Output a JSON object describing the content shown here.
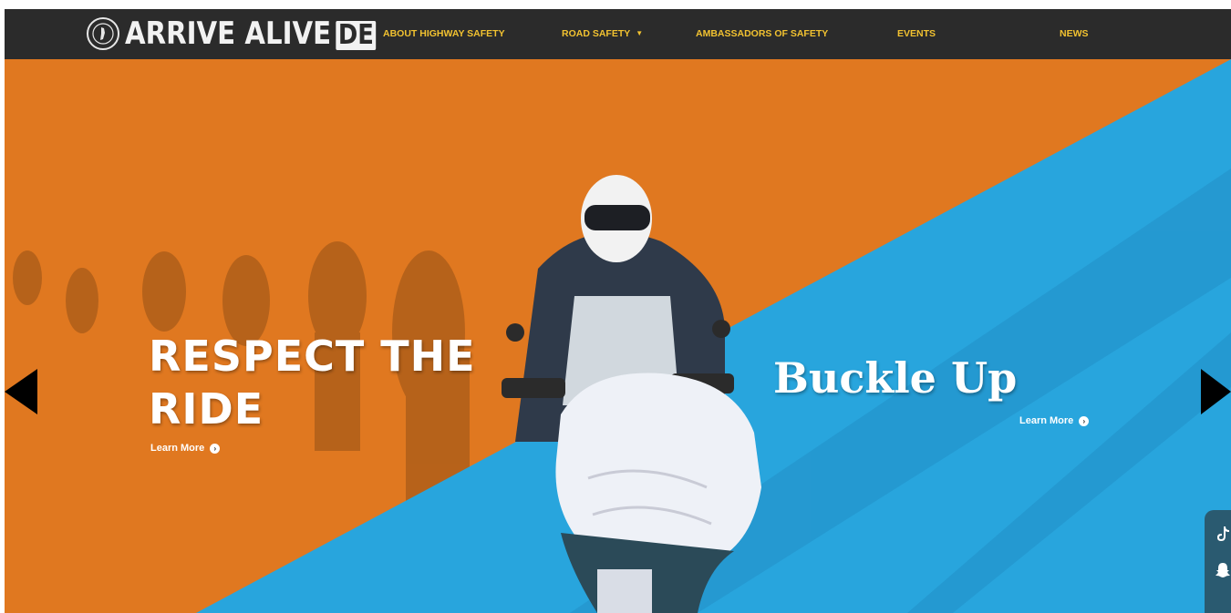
{
  "brand": {
    "logo_text": "ARRIVE ALIVE",
    "badge_text": "DE"
  },
  "nav": {
    "items": [
      {
        "label": "ABOUT HIGHWAY SAFETY"
      },
      {
        "label": "ROAD SAFETY"
      },
      {
        "label": "AMBASSADORS OF SAFETY"
      },
      {
        "label": "EVENTS"
      },
      {
        "label": "NEWS"
      }
    ]
  },
  "slides": [
    {
      "title_line1": "RESPECT THE",
      "title_line2": "RIDE",
      "cta": "Learn More"
    },
    {
      "title": "Buckle Up",
      "cta": "Learn More"
    }
  ],
  "colors": {
    "nav_bg": "#2b2b2b",
    "nav_text": "#f2c230",
    "orange": "#e07820",
    "blue": "#28a5dd",
    "social_bg": "#2a5a70"
  },
  "icons": {
    "prev": "triangle-left-icon",
    "next": "triangle-right-icon",
    "tiktok": "tiktok-icon",
    "snapchat": "snapchat-icon",
    "cta": "chevron-circle-right-icon"
  }
}
